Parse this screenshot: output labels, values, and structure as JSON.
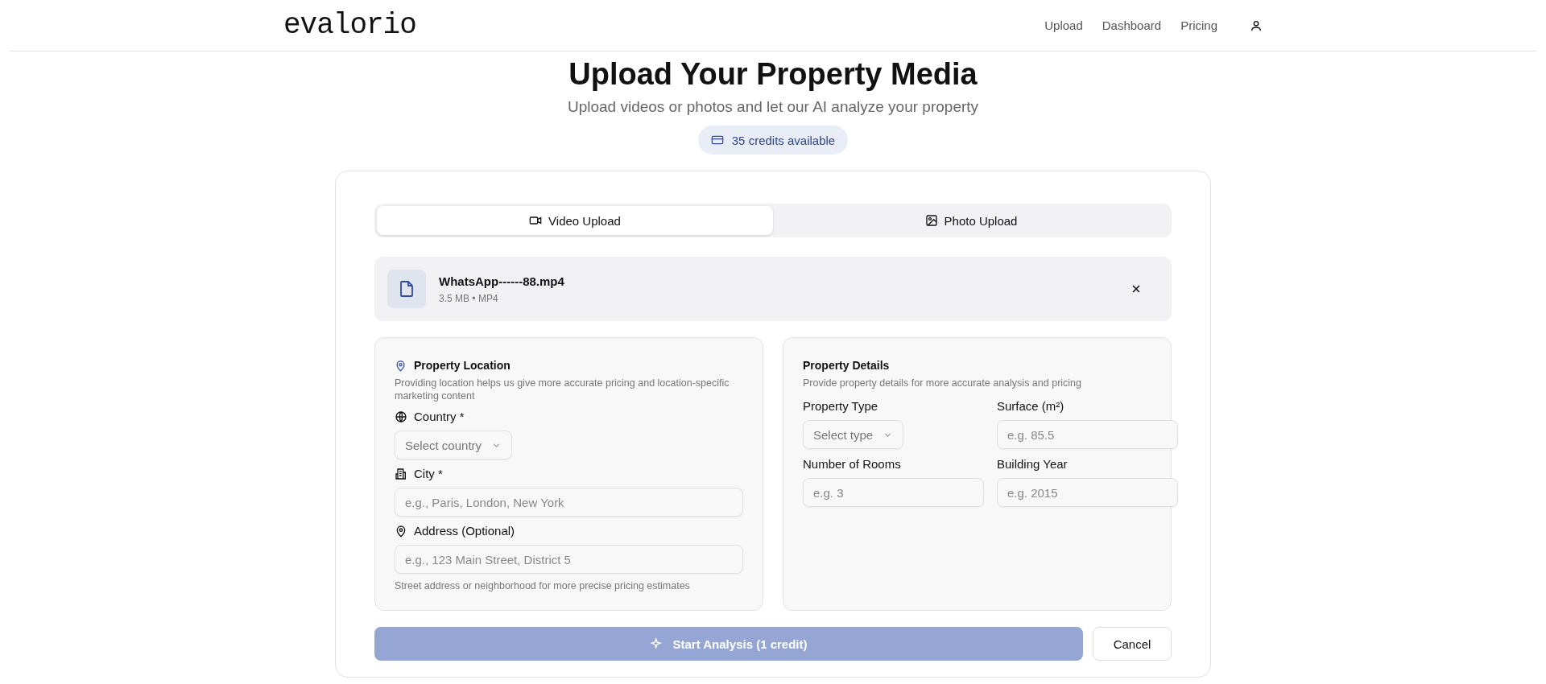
{
  "header": {
    "logo": "evalorio",
    "nav": [
      {
        "label": "Upload"
      },
      {
        "label": "Dashboard"
      },
      {
        "label": "Pricing"
      }
    ]
  },
  "title": "Upload Your Property Media",
  "subtitle": "Upload videos or photos and let our AI analyze your property",
  "credits": "35 credits available",
  "tabs": [
    {
      "label": "Video Upload",
      "kind": "video",
      "selected": true
    },
    {
      "label": "Photo Upload",
      "kind": "photo",
      "selected": false
    }
  ],
  "file": {
    "name": "WhatsApp------88.mp4",
    "meta": "3.5 MB • MP4"
  },
  "location": {
    "title": "Property Location",
    "description": "Providing location helps us give more accurate pricing and location-specific marketing content",
    "fields": [
      {
        "kind": "select",
        "label": "Country *",
        "placeholder": "Select country"
      },
      {
        "kind": "input",
        "label": "City *",
        "placeholder": "e.g., Paris, London, New York"
      },
      {
        "kind": "input",
        "label": "Address (Optional)",
        "placeholder": "e.g., 123 Main Street, District 5"
      }
    ],
    "hint": "Street address or neighborhood for more precise pricing estimates"
  },
  "details": {
    "title": "Property Details",
    "description": "Provide property details for more accurate analysis and pricing",
    "fields": [
      {
        "kind": "select",
        "label": "Property Type",
        "placeholder": "Select type"
      },
      {
        "kind": "input",
        "label": "Surface (m²)",
        "placeholder": "e.g. 85.5"
      },
      {
        "kind": "input",
        "label": "Number of Rooms",
        "placeholder": "e.g. 3"
      },
      {
        "kind": "input",
        "label": "Building Year",
        "placeholder": "e.g. 2015"
      }
    ]
  },
  "actions": {
    "start": "Start Analysis (1 credit)",
    "start_disabled": true,
    "cancel": "Cancel"
  }
}
